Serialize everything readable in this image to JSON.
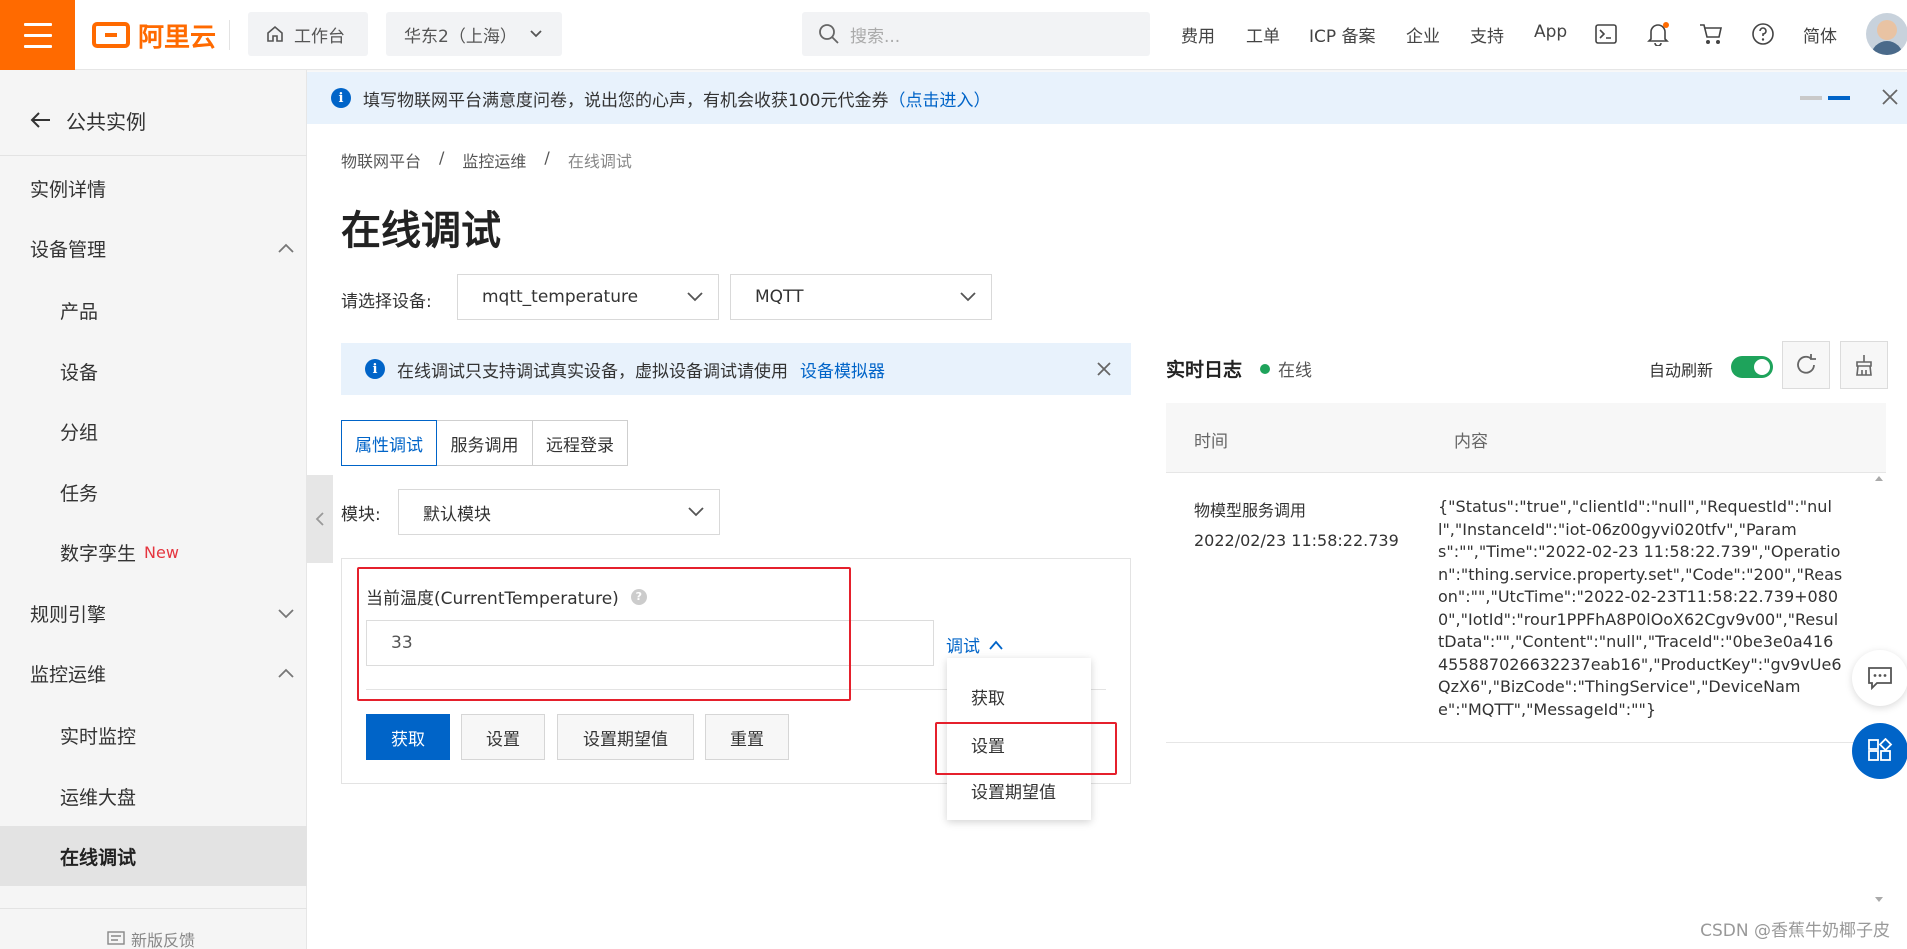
{
  "header": {
    "logo_text": "阿里云",
    "workbench": "工作台",
    "region": "华东2（上海）",
    "search_placeholder": "搜索...",
    "nav": [
      "费用",
      "工单",
      "ICP 备案",
      "企业",
      "支持",
      "App"
    ],
    "lang": "简体"
  },
  "sidebar": {
    "back_label": "公共实例",
    "items": [
      {
        "label": "实例详情"
      },
      {
        "label": "设备管理"
      },
      {
        "label": "产品"
      },
      {
        "label": "设备"
      },
      {
        "label": "分组"
      },
      {
        "label": "任务"
      },
      {
        "label": "数字孪生",
        "badge": "New"
      },
      {
        "label": "规则引擎"
      },
      {
        "label": "监控运维"
      },
      {
        "label": "实时监控"
      },
      {
        "label": "运维大盘"
      },
      {
        "label": "在线调试"
      }
    ],
    "feedback": "新版反馈"
  },
  "banner": {
    "text": "填写物联网平台满意度问卷，说出您的心声，有机会收获100元代金券",
    "link": "（点击进入）"
  },
  "breadcrumb": [
    "物联网平台",
    "/",
    "监控运维",
    "/",
    "在线调试"
  ],
  "page_title": "在线调试",
  "device_select": {
    "label": "请选择设备:",
    "device": "mqtt_temperature",
    "protocol": "MQTT"
  },
  "info": {
    "text": "在线调试只支持调试真实设备，虚拟设备调试请使用",
    "link": "设备模拟器"
  },
  "tabs": [
    "属性调试",
    "服务调用",
    "远程登录"
  ],
  "module": {
    "label": "模块:",
    "value": "默认模块"
  },
  "property": {
    "label": "当前温度(CurrentTemperature)",
    "value": "33",
    "debug_label": "调试"
  },
  "dropdown": [
    "获取",
    "设置",
    "设置期望值"
  ],
  "buttons": [
    "获取",
    "设置",
    "设置期望值",
    "重置"
  ],
  "log": {
    "title": "实时日志",
    "status": "在线",
    "auto_refresh": "自动刷新",
    "columns": [
      "时间",
      "内容"
    ],
    "rows": [
      {
        "type": "物模型服务调用",
        "time": "2022/02/23 11:58:22.739",
        "content": "{\"Status\":\"true\",\"clientId\":\"null\",\"RequestId\":\"null\",\"InstanceId\":\"iot-06z00gyvi020tfv\",\"Params\":\"\",\"Time\":\"2022-02-23 11:58:22.739\",\"Operation\":\"thing.service.property.set\",\"Code\":\"200\",\"Reason\":\"\",\"UtcTime\":\"2022-02-23T11:58:22.739+0800\",\"IotId\":\"rour1PPFhA8P0lOoX62Cgv9v00\",\"ResultData\":\"\",\"Content\":\"null\",\"TraceId\":\"0be3e0a416455887026632237eab16\",\"ProductKey\":\"gv9vUe6QzX6\",\"BizCode\":\"ThingService\",\"DeviceName\":\"MQTT\",\"MessageId\":\"\"}"
      }
    ]
  },
  "watermark": "CSDN @香蕉牛奶椰子皮",
  "colors": {
    "brand": "#ff6a00",
    "primary": "#0064c8",
    "highlight": "#e5202c",
    "online": "#1ea35b"
  }
}
